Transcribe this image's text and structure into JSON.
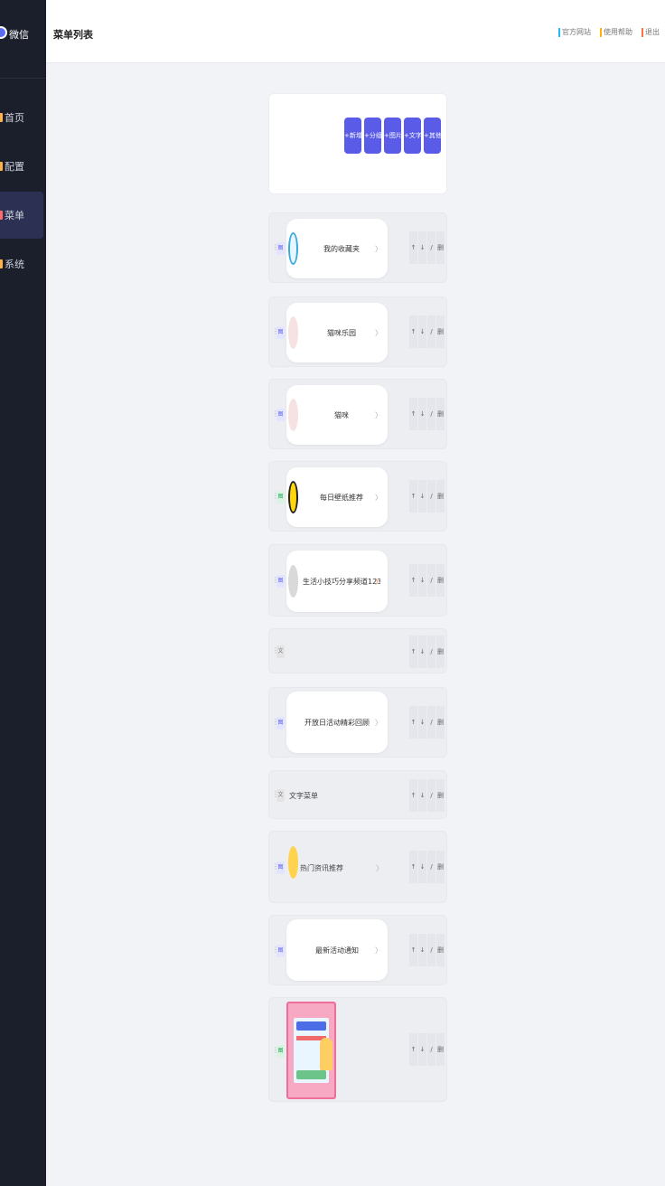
{
  "app": {
    "brand_text": "微信"
  },
  "sidebar": {
    "items": [
      {
        "label": "首页"
      },
      {
        "label": "配置"
      },
      {
        "label": "菜单"
      },
      {
        "label": "系统"
      }
    ],
    "active_index": 2
  },
  "header": {
    "title": "菜单列表",
    "links": [
      "官方网站",
      "使用帮助",
      "退出"
    ]
  },
  "toolbar": {
    "buttons": [
      "+新增",
      "+分组",
      "+图片",
      "+文字",
      "+其他"
    ]
  },
  "rows": [
    {
      "tag": "图标",
      "title": "我的收藏夹",
      "icon": "eye-circle-icon",
      "tag_style": "blue"
    },
    {
      "tag": "图标",
      "title": "猫咪乐园",
      "icon": "cat-icon",
      "tag_style": "blue"
    },
    {
      "tag": "图标",
      "title": "猫咪",
      "icon": "cat-icon",
      "tag_style": "blue"
    },
    {
      "tag": "图标",
      "title": "每日壁纸推荐",
      "icon": "number-seven-icon",
      "tag_style": "green"
    },
    {
      "tag": "图标",
      "title": "生活小技巧分享频道1234",
      "icon": "dog-icon",
      "tag_style": "blue"
    },
    {
      "tag": "文字",
      "title": "",
      "icon": "",
      "tag_style": "gray"
    },
    {
      "tag": "图标",
      "title": "开放日活动精彩回顾",
      "icon": "",
      "tag_style": "blue"
    },
    {
      "tag": "文字",
      "title": "文字菜单",
      "icon": "",
      "tag_style": "gray"
    },
    {
      "tag": "图标",
      "title": "热门资讯推荐",
      "icon": "chat-bubble-icon",
      "tag_style": "blue"
    },
    {
      "tag": "图标",
      "title": "最新活动通知",
      "icon": "",
      "tag_style": "blue"
    },
    {
      "tag": "图片",
      "title": "",
      "icon": "poster-image",
      "tag_style": "green"
    }
  ],
  "row_actions": [
    "↑",
    "↓",
    "/",
    "删"
  ],
  "colors": {
    "sidebar_bg": "#1b1e2b",
    "accent": "#5a5ce8",
    "page_bg": "#f1f3f6"
  }
}
